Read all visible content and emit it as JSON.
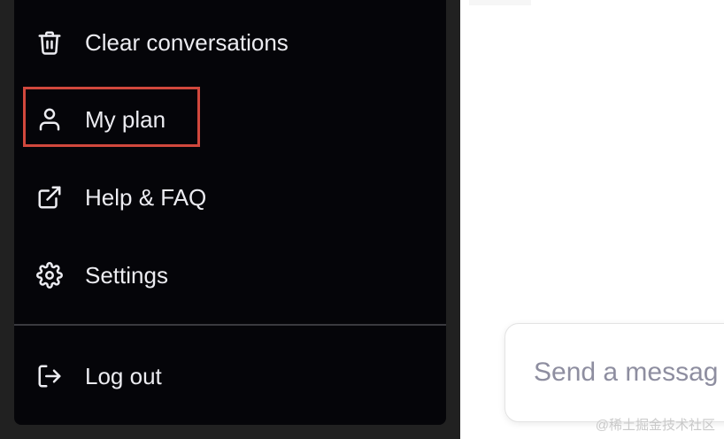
{
  "menu": {
    "items": [
      {
        "label": "Clear conversations",
        "icon": "trash-icon"
      },
      {
        "label": "My plan",
        "icon": "user-icon"
      },
      {
        "label": "Help & FAQ",
        "icon": "external-link-icon"
      },
      {
        "label": "Settings",
        "icon": "gear-icon"
      },
      {
        "label": "Log out",
        "icon": "logout-icon"
      }
    ]
  },
  "composer": {
    "placeholder": "Send a messag"
  },
  "watermark": "@稀土掘金技术社区",
  "colors": {
    "menu_bg": "#050509",
    "sidebar_bg": "#212121",
    "menu_text": "#ececf1",
    "highlight": "#d1483d",
    "placeholder": "#8e8ea0"
  }
}
